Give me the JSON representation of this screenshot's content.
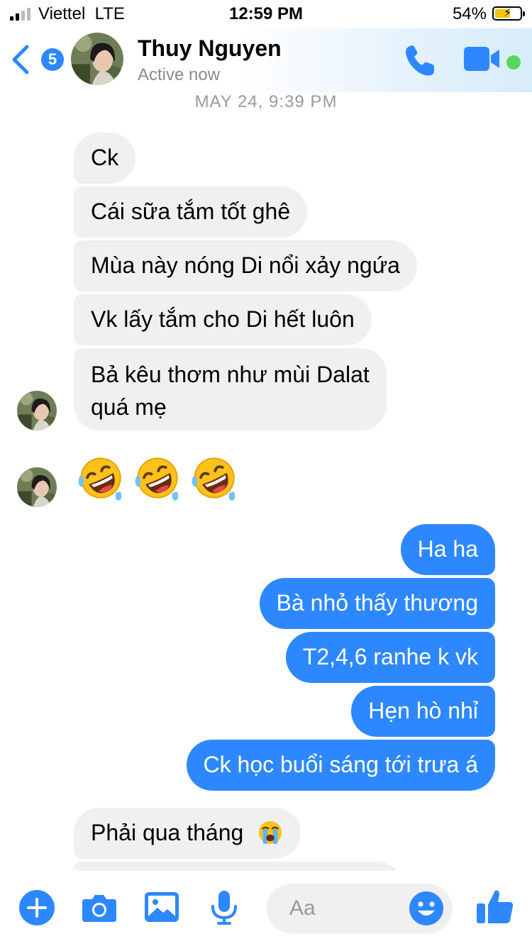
{
  "status_bar": {
    "carrier": "Viettel",
    "network": "LTE",
    "time": "12:59 PM",
    "battery": "54%"
  },
  "header": {
    "unread_count": "5",
    "contact_name": "Thuy Nguyen",
    "contact_status": "Active now"
  },
  "timestamp": "MAY 24, 9:39 PM",
  "messages": [
    {
      "from": "them",
      "text": "Ck"
    },
    {
      "from": "them",
      "text": "Cái sữa tắm tốt ghê"
    },
    {
      "from": "them",
      "text": "Mùa này nóng Di nổi xảy ngứa"
    },
    {
      "from": "them",
      "text": "Vk lấy tắm cho Di hết luôn"
    },
    {
      "from": "them",
      "text_line1": "Bả kêu thơm như mùi Dalat",
      "text_line2": "quá mẹ"
    },
    {
      "from": "them",
      "emoji": [
        "rolling-on-floor-laughing",
        "rolling-on-floor-laughing",
        "rolling-on-floor-laughing"
      ]
    },
    {
      "from": "me",
      "text": "Ha ha"
    },
    {
      "from": "me",
      "text": "Bà nhỏ thấy thương"
    },
    {
      "from": "me",
      "text": "T2,4,6 ranhe k vk"
    },
    {
      "from": "me",
      "text": "Hẹn hò nhỉ"
    },
    {
      "from": "me",
      "text": "Ck học buổi sáng tới trưa á"
    },
    {
      "from": "them",
      "text": "Phải qua tháng",
      "emoji": "loudly-crying"
    }
  ],
  "composer": {
    "placeholder": "Aa",
    "icons": [
      "plus-icon",
      "camera-icon",
      "image-icon",
      "microphone-icon",
      "smiley-icon",
      "thumbs-up-icon"
    ]
  },
  "colors": {
    "accent": "#2d88ff",
    "incoming_bubble": "#f0f0f0",
    "active_green": "#5ad65a"
  }
}
